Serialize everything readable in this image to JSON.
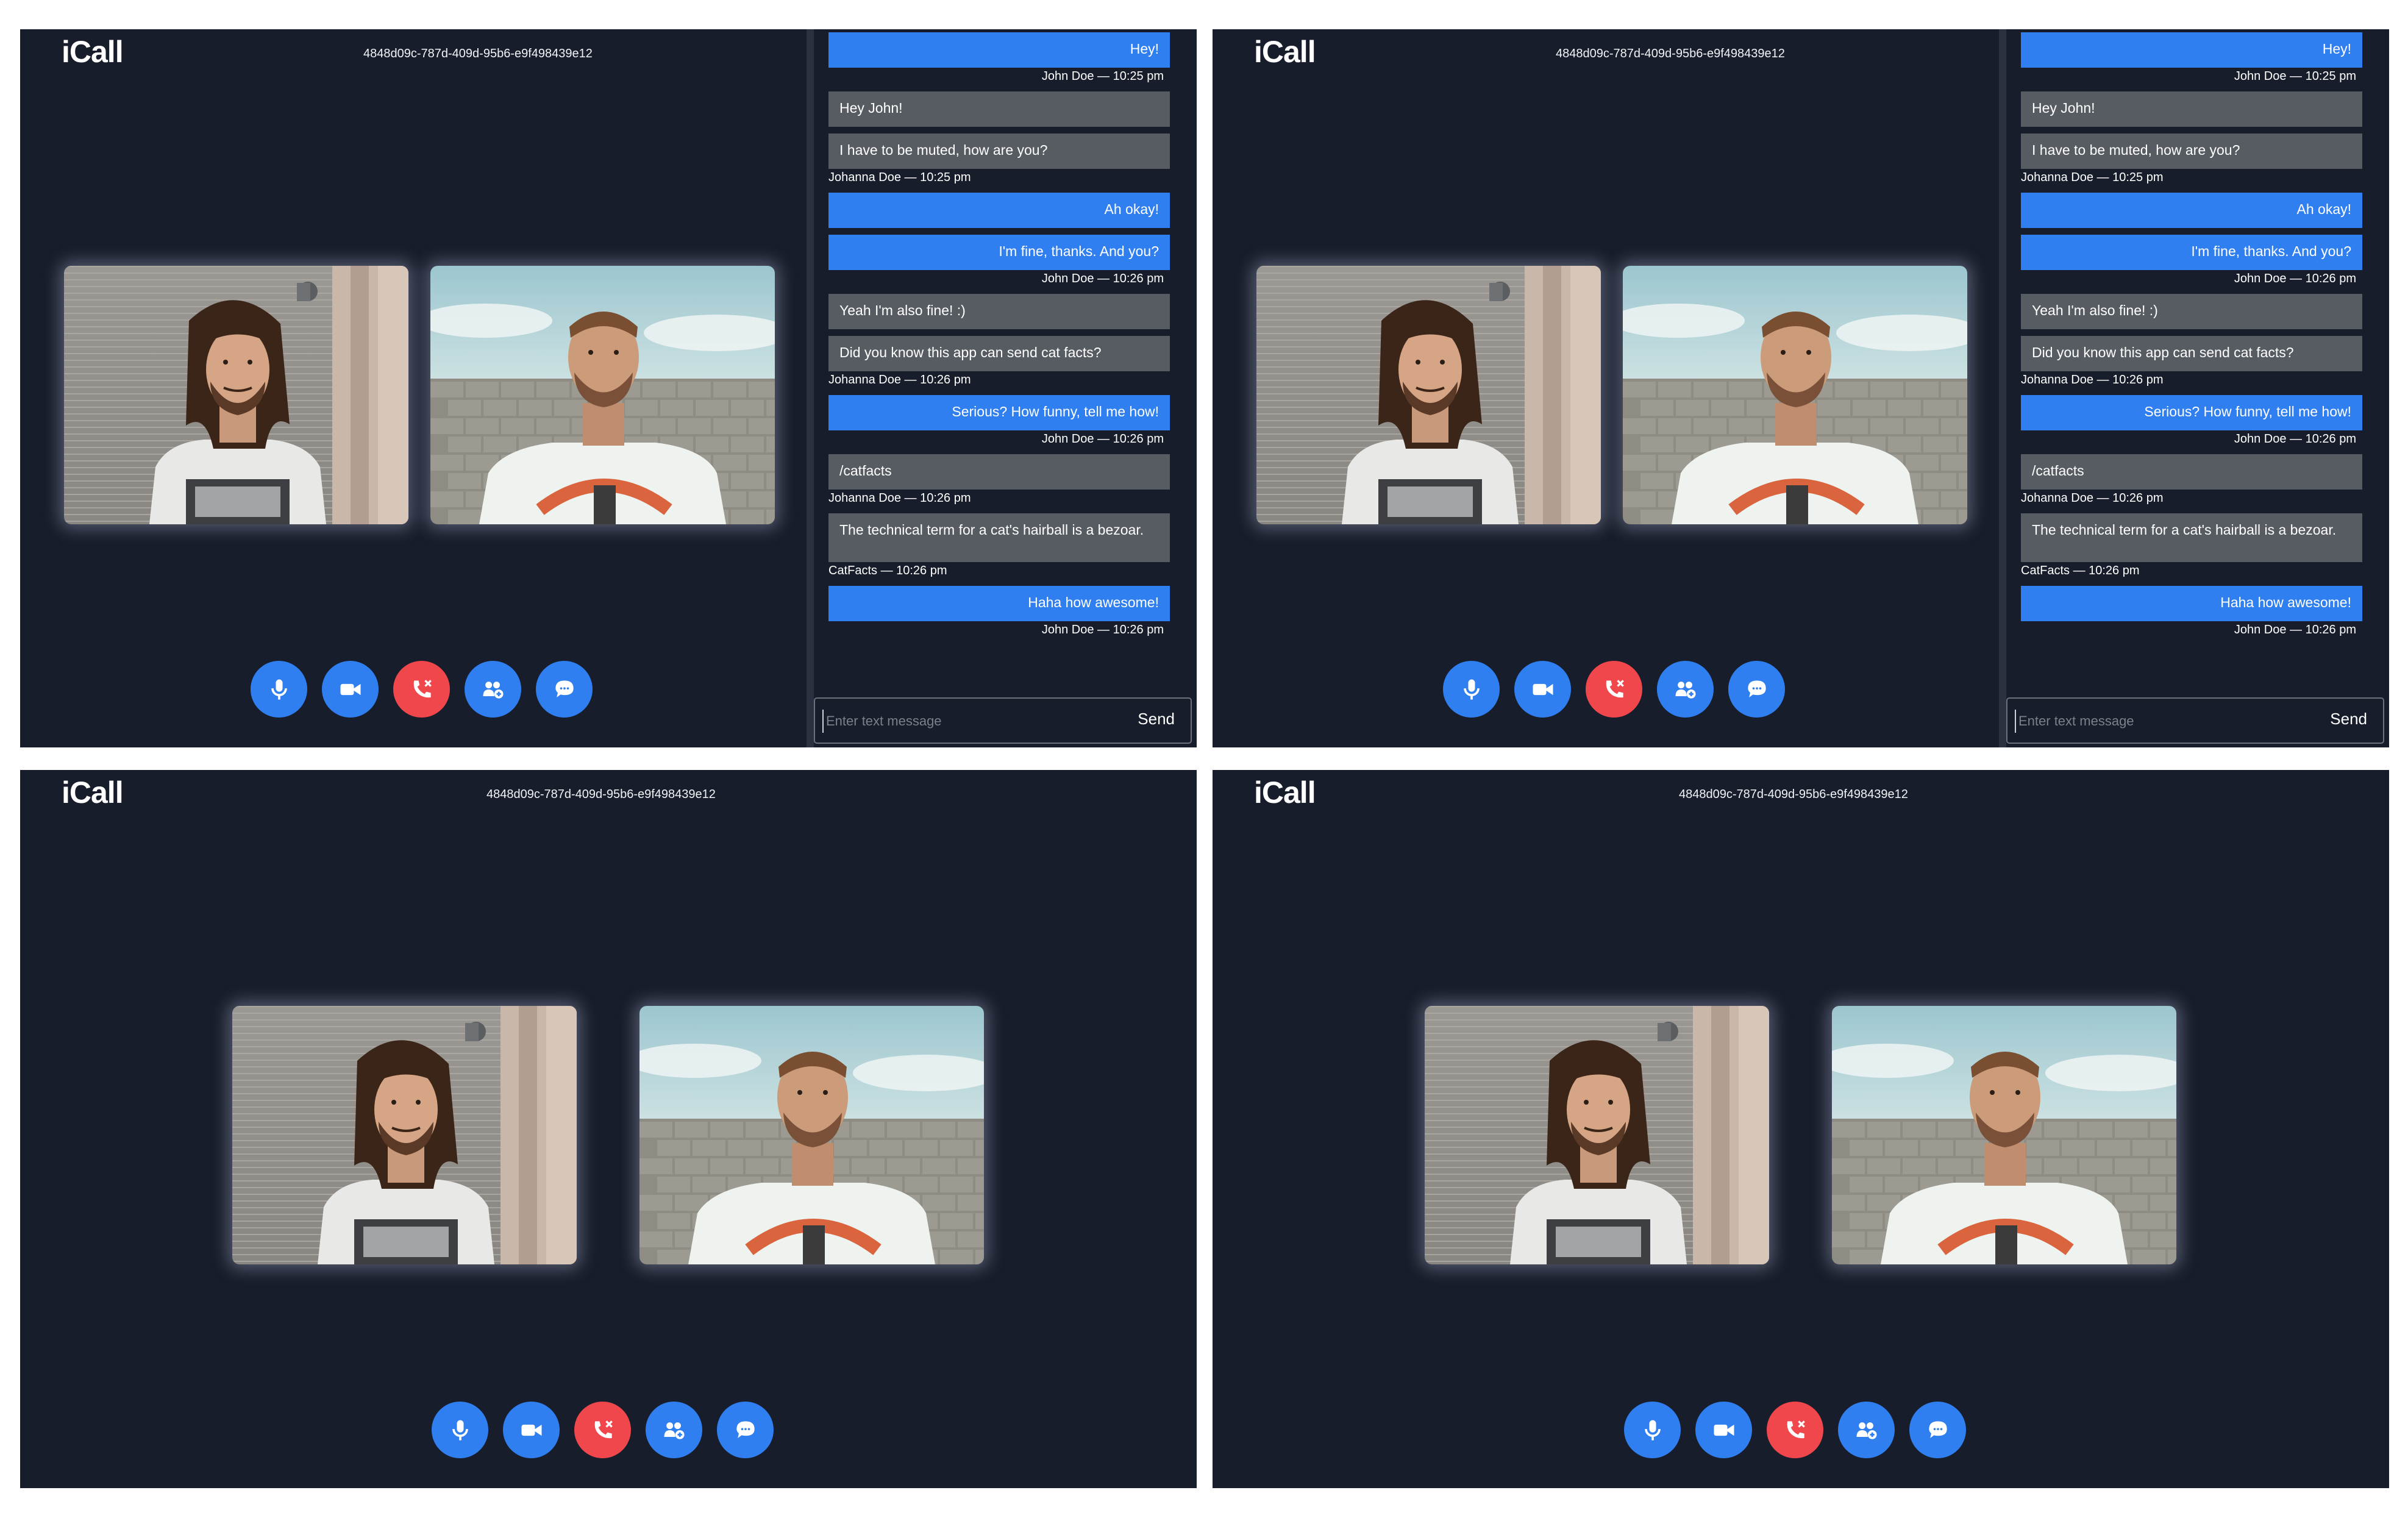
{
  "app": {
    "logo": "iCall",
    "call_id": "4848d09c-787d-409d-95b6-e9f498439e12"
  },
  "participants": [
    {
      "label": "participant-1",
      "desc": "man with dreadlocks"
    },
    {
      "label": "participant-2",
      "desc": "man in cast clothing shirt"
    }
  ],
  "controls": [
    {
      "name": "mute-button",
      "icon": "microphone-icon"
    },
    {
      "name": "camera-button",
      "icon": "video-camera-icon"
    },
    {
      "name": "end-call-button",
      "icon": "phone-hangup-icon",
      "color": "#f0474d"
    },
    {
      "name": "participants-button",
      "icon": "users-add-icon"
    },
    {
      "name": "chat-button",
      "icon": "chat-bubble-icon"
    }
  ],
  "colors": {
    "background": "#181d2b",
    "accent": "#2f7ff0",
    "danger": "#f0474d",
    "received_bubble": "#575b62"
  },
  "chat": {
    "messages": [
      {
        "type": "sent",
        "text": "Hey!",
        "meta": "John Doe  — 10:25 pm"
      },
      {
        "type": "recv",
        "text": "Hey John!"
      },
      {
        "type": "recv",
        "text": "I have to be muted, how are you?",
        "meta": "Johanna Doe  — 10:25 pm"
      },
      {
        "type": "sent",
        "text": "Ah okay!"
      },
      {
        "type": "sent",
        "text": "I'm fine, thanks. And you?",
        "meta": "John Doe  — 10:26 pm"
      },
      {
        "type": "recv",
        "text": "Yeah I'm also fine! :)"
      },
      {
        "type": "recv",
        "text": "Did you know this app can send cat facts?",
        "meta": "Johanna Doe  — 10:26 pm"
      },
      {
        "type": "sent",
        "text": "Serious? How funny, tell me how!",
        "meta": "John Doe  — 10:26 pm"
      },
      {
        "type": "recv",
        "text": "/catfacts",
        "meta": "Johanna Doe  — 10:26 pm"
      },
      {
        "type": "recv",
        "text": "The technical term for a cat's hairball is a bezoar.",
        "meta": "CatFacts  — 10:26 pm"
      },
      {
        "type": "sent",
        "text": "Haha how awesome!",
        "meta": "John Doe  — 10:26 pm"
      }
    ],
    "input_placeholder": "Enter text message",
    "send_label": "Send"
  }
}
